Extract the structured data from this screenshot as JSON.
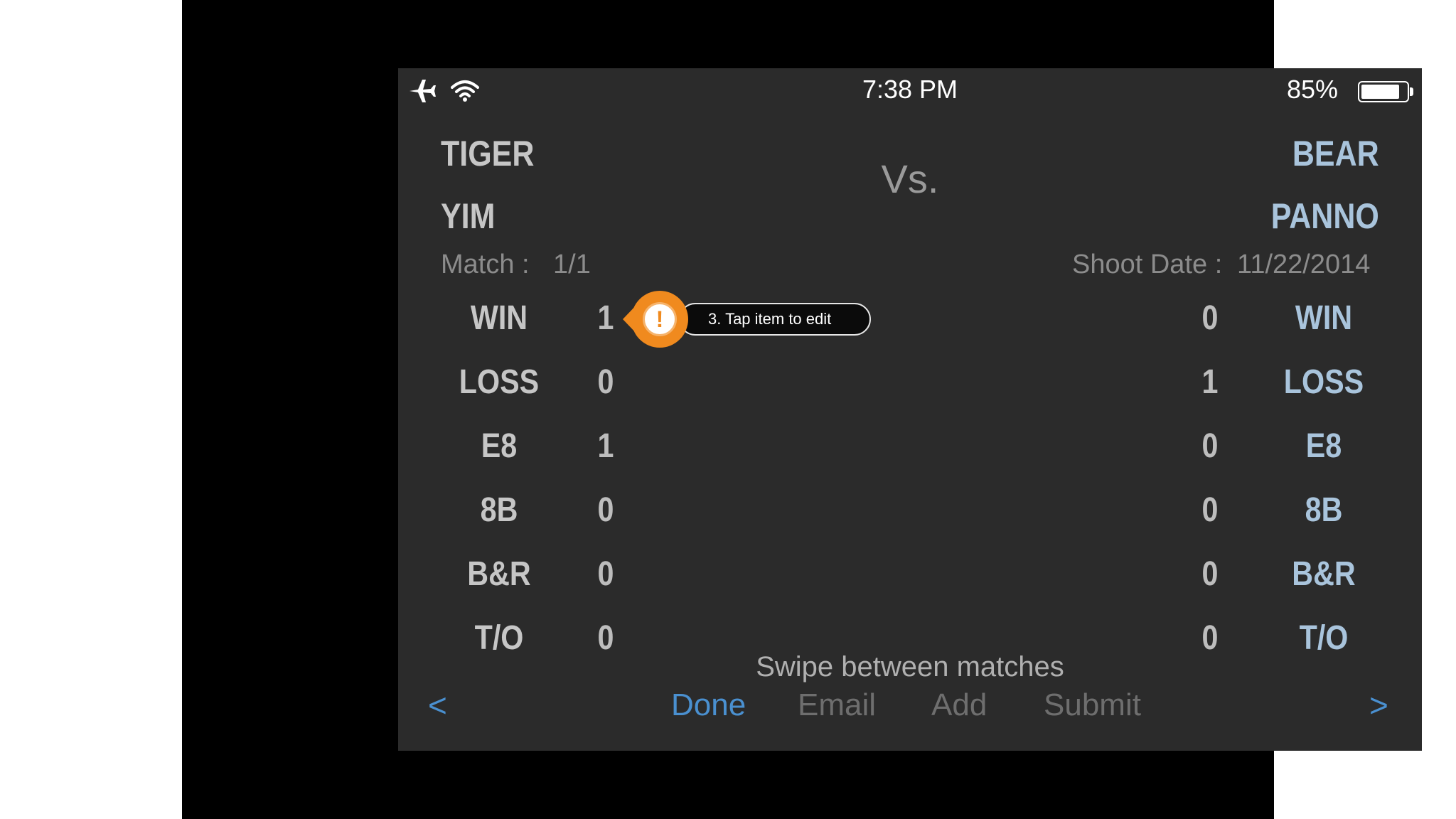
{
  "status_bar": {
    "time": "7:38 PM",
    "battery_percent_label": "85%",
    "battery_level": 0.85,
    "icons": [
      "airplane-icon",
      "wifi-icon",
      "battery-icon"
    ]
  },
  "players": {
    "left": {
      "first": "TIGER",
      "last": "YIM"
    },
    "right": {
      "first": "BEAR",
      "last": "PANNO"
    }
  },
  "vs_label": "Vs.",
  "match": {
    "label": "Match :",
    "value": "1/1"
  },
  "shoot_date": {
    "label": "Shoot Date :",
    "value": "11/22/2014"
  },
  "stats": [
    {
      "label": "WIN",
      "left": "1",
      "right": "0"
    },
    {
      "label": "LOSS",
      "left": "0",
      "right": "1"
    },
    {
      "label": "E8",
      "left": "1",
      "right": "0"
    },
    {
      "label": "8B",
      "left": "0",
      "right": "0"
    },
    {
      "label": "B&R",
      "left": "0",
      "right": "0"
    },
    {
      "label": "T/O",
      "left": "0",
      "right": "0"
    }
  ],
  "tooltip": {
    "icon_text": "!",
    "text": "3. Tap item to edit"
  },
  "hint": "Swipe between matches",
  "toolbar": {
    "prev": "<",
    "next": ">",
    "done": "Done",
    "email": "Email",
    "add": "Add",
    "submit": "Submit"
  },
  "colors": {
    "accent": "#4a90d0",
    "tooltip_orange": "#f08a1e",
    "right_player": "#a9c4dc",
    "background": "#2b2b2b"
  }
}
